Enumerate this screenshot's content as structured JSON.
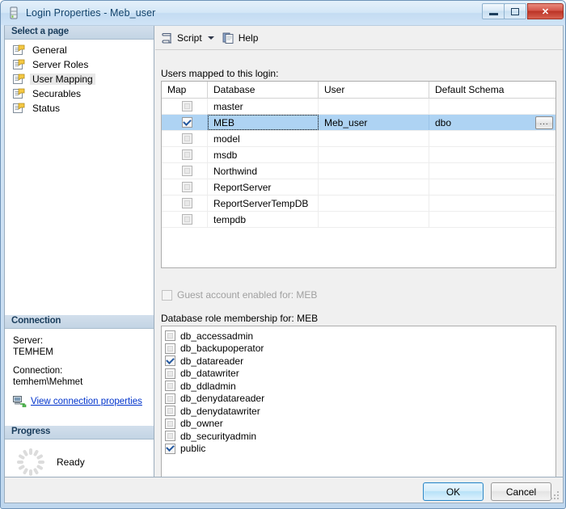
{
  "window": {
    "title": "Login Properties - Meb_user",
    "icon": "server-icon",
    "controls": {
      "minimize": "minimize-icon",
      "maximize": "maximize-icon",
      "close": "✕"
    }
  },
  "sidebar": {
    "header": "Select a page",
    "items": [
      {
        "label": "General",
        "selected": false,
        "icon": "page-icon"
      },
      {
        "label": "Server Roles",
        "selected": false,
        "icon": "page-icon"
      },
      {
        "label": "User Mapping",
        "selected": true,
        "icon": "page-icon"
      },
      {
        "label": "Securables",
        "selected": false,
        "icon": "page-icon"
      },
      {
        "label": "Status",
        "selected": false,
        "icon": "page-icon"
      }
    ],
    "connection": {
      "header": "Connection",
      "server_label": "Server:",
      "server_value": "TEMHEM",
      "connection_label": "Connection:",
      "connection_value": "temhem\\Mehmet",
      "link": "View connection properties",
      "link_icon": "network-computer-icon"
    },
    "progress": {
      "header": "Progress",
      "status": "Ready",
      "icon": "spinner-icon"
    }
  },
  "toolbar": {
    "script_label": "Script",
    "script_icon": "script-icon",
    "dropdown_icon": "chevron-down-icon",
    "help_label": "Help",
    "help_icon": "help-book-icon"
  },
  "main": {
    "grid_label": "Users mapped to this login:",
    "columns": [
      "Map",
      "Database",
      "User",
      "Default Schema"
    ],
    "rows": [
      {
        "map": false,
        "database": "master",
        "user": "",
        "schema": "",
        "selected": false
      },
      {
        "map": true,
        "database": "MEB",
        "user": "Meb_user",
        "schema": "dbo",
        "selected": true,
        "ellipsis": "..."
      },
      {
        "map": false,
        "database": "model",
        "user": "",
        "schema": "",
        "selected": false
      },
      {
        "map": false,
        "database": "msdb",
        "user": "",
        "schema": "",
        "selected": false
      },
      {
        "map": false,
        "database": "Northwind",
        "user": "",
        "schema": "",
        "selected": false
      },
      {
        "map": false,
        "database": "ReportServer",
        "user": "",
        "schema": "",
        "selected": false
      },
      {
        "map": false,
        "database": "ReportServerTempDB",
        "user": "",
        "schema": "",
        "selected": false
      },
      {
        "map": false,
        "database": "tempdb",
        "user": "",
        "schema": "",
        "selected": false
      }
    ],
    "guest_checkbox": {
      "label": "Guest account enabled for: MEB",
      "checked": false,
      "disabled": true
    },
    "role_label": "Database role membership for: MEB",
    "roles": [
      {
        "label": "db_accessadmin",
        "checked": false
      },
      {
        "label": "db_backupoperator",
        "checked": false
      },
      {
        "label": "db_datareader",
        "checked": true
      },
      {
        "label": "db_datawriter",
        "checked": false
      },
      {
        "label": "db_ddladmin",
        "checked": false
      },
      {
        "label": "db_denydatareader",
        "checked": false
      },
      {
        "label": "db_denydatawriter",
        "checked": false
      },
      {
        "label": "db_owner",
        "checked": false
      },
      {
        "label": "db_securityadmin",
        "checked": false
      },
      {
        "label": "public",
        "checked": true
      }
    ]
  },
  "footer": {
    "ok_label": "OK",
    "cancel_label": "Cancel"
  },
  "colors": {
    "selection": "#aed3f3",
    "link": "#0033cc",
    "title_text": "#12436b",
    "panel_header": "#c3d4e4",
    "close_button": "#bb3326"
  }
}
